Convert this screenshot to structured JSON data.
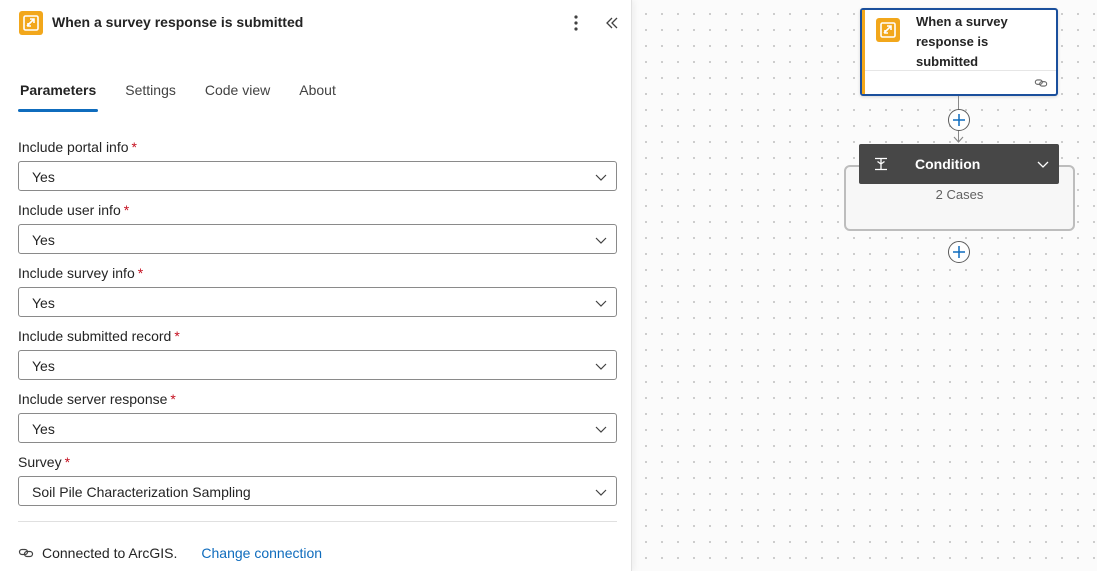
{
  "panel": {
    "title": "When a survey response is submitted",
    "tabs": [
      {
        "label": "Parameters",
        "active": true
      },
      {
        "label": "Settings",
        "active": false
      },
      {
        "label": "Code view",
        "active": false
      },
      {
        "label": "About",
        "active": false
      }
    ],
    "fields": [
      {
        "label": "Include portal info",
        "required_mark": "*",
        "value": "Yes"
      },
      {
        "label": "Include user info",
        "required_mark": "*",
        "value": "Yes"
      },
      {
        "label": "Include survey info",
        "required_mark": "*",
        "value": "Yes"
      },
      {
        "label": "Include submitted record",
        "required_mark": "*",
        "value": "Yes"
      },
      {
        "label": "Include server response",
        "required_mark": "*",
        "value": "Yes"
      },
      {
        "label": "Survey",
        "required_mark": "*",
        "value": "Soil Pile Characterization Sampling"
      }
    ],
    "connection": {
      "text": "Connected to ArcGIS.",
      "link": "Change connection"
    }
  },
  "canvas": {
    "trigger_node": {
      "title": "When a survey response is submitted"
    },
    "condition_node": {
      "title": "Condition",
      "cases": "2 Cases"
    }
  },
  "colors": {
    "accent": "#0f6cbd",
    "connector_orange": "#f2a71b",
    "required": "#c50f1f",
    "condition_header": "#474747",
    "selected_border": "#1a4f9c"
  },
  "icons": {
    "app": "arcgis-survey-icon",
    "more": "more-vertical-icon",
    "collapse": "double-chevron-left-icon",
    "dropdown": "chevron-down-icon",
    "connection": "link-icon",
    "add": "plus-circle-icon",
    "condition": "condition-icon"
  }
}
